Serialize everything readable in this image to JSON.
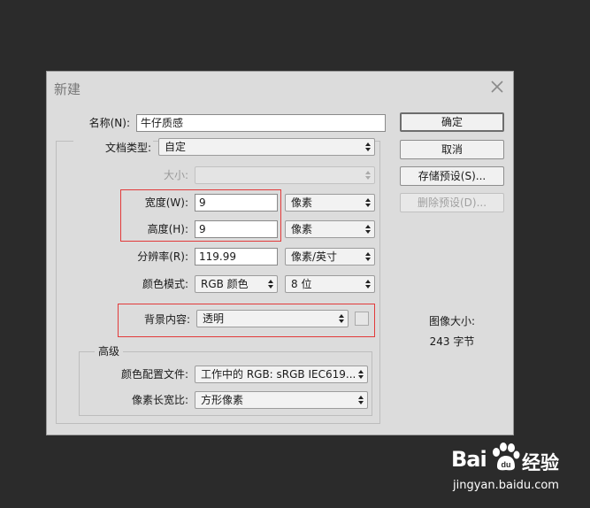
{
  "dialog": {
    "title": "新建",
    "name_label": "名称(N):",
    "name_value": "牛仔质感",
    "doc_type_label": "文档类型:",
    "doc_type_value": "自定",
    "size_label": "大小:",
    "size_value": "",
    "width_label": "宽度(W):",
    "width_value": "9",
    "width_unit": "像素",
    "height_label": "高度(H):",
    "height_value": "9",
    "height_unit": "像素",
    "resolution_label": "分辨率(R):",
    "resolution_value": "119.99",
    "resolution_unit": "像素/英寸",
    "color_mode_label": "颜色模式:",
    "color_mode_value": "RGB 颜色",
    "bit_depth_value": "8 位",
    "background_label": "背景内容:",
    "background_value": "透明",
    "advanced_label": "高级",
    "color_profile_label": "颜色配置文件:",
    "color_profile_value": "工作中的 RGB: sRGB IEC619...",
    "pixel_aspect_label": "像素长宽比:",
    "pixel_aspect_value": "方形像素",
    "image_size_label": "图像大小:",
    "image_size_value": "243 字节"
  },
  "buttons": {
    "ok": "确定",
    "cancel": "取消",
    "save_preset": "存储预设(S)...",
    "delete_preset": "删除预设(D)..."
  },
  "watermark": {
    "brand": "Bai",
    "brand2": "经验",
    "url": "jingyan.baidu.com"
  },
  "colors": {
    "background": "#2b2b2b",
    "dialog": "#dcdcdc",
    "highlight": "#e23a3a"
  }
}
